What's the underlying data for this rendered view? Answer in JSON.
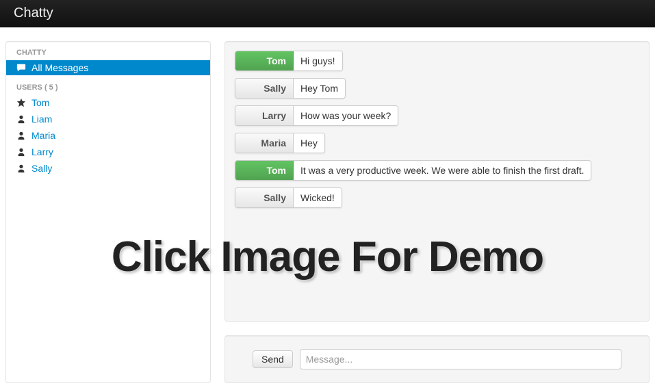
{
  "app": {
    "brand": "Chatty"
  },
  "sidebar": {
    "section1_header": "CHATTY",
    "all_messages_label": "All Messages",
    "section2_header": "USERS ( 5 )",
    "users": [
      {
        "name": "Tom",
        "is_self": true
      },
      {
        "name": "Liam",
        "is_self": false
      },
      {
        "name": "Maria",
        "is_self": false
      },
      {
        "name": "Larry",
        "is_self": false
      },
      {
        "name": "Sally",
        "is_self": false
      }
    ]
  },
  "messages": [
    {
      "sender": "Tom",
      "text": "Hi guys!",
      "is_self": true
    },
    {
      "sender": "Sally",
      "text": "Hey Tom",
      "is_self": false
    },
    {
      "sender": "Larry",
      "text": "How was your week?",
      "is_self": false
    },
    {
      "sender": "Maria",
      "text": "Hey",
      "is_self": false
    },
    {
      "sender": "Tom",
      "text": "It was a very productive week. We were able to finish the first draft.",
      "is_self": true
    },
    {
      "sender": "Sally",
      "text": "Wicked!",
      "is_self": false
    }
  ],
  "composer": {
    "send_label": "Send",
    "placeholder": "Message..."
  },
  "overlay": "Click Image For Demo"
}
